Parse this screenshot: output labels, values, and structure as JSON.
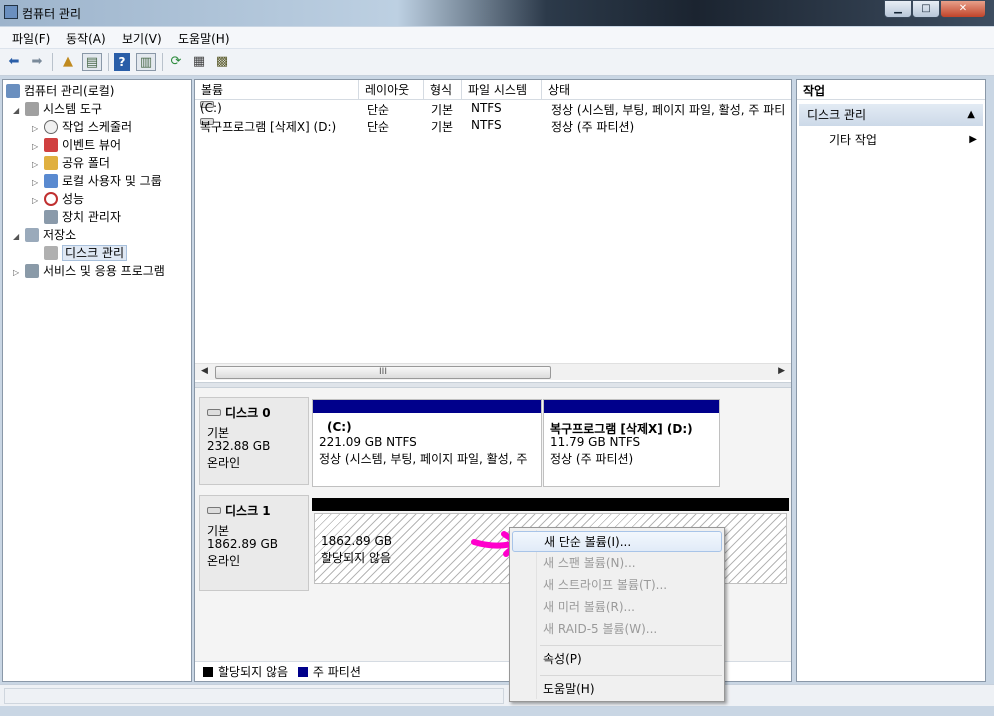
{
  "window": {
    "title": "컴퓨터 관리"
  },
  "window_buttons": {
    "minimize": "▁",
    "maximize": "□",
    "close": "✕"
  },
  "menubar": [
    "파일(F)",
    "동작(A)",
    "보기(V)",
    "도움말(H)"
  ],
  "toolbar": {
    "icons": [
      "back-arrow-icon",
      "forward-arrow-icon",
      "up-folder-icon",
      "show-hide-tree-icon",
      "help-icon",
      "show-hide-action-pane-icon",
      "refresh-icon",
      "properties-icon",
      "export-list-icon"
    ]
  },
  "tree": {
    "root": "컴퓨터 관리(로컬)",
    "system_tools": "시스템 도구",
    "task_scheduler": "작업 스케줄러",
    "event_viewer": "이벤트 뷰어",
    "shared_folders": "공유 폴더",
    "local_users": "로컬 사용자 및 그룹",
    "performance": "성능",
    "device_manager": "장치 관리자",
    "storage": "저장소",
    "disk_management": "디스크 관리",
    "services": "서비스 및 응용 프로그램"
  },
  "volume_list": {
    "columns": [
      "볼륨",
      "레이아웃",
      "형식",
      "파일 시스템",
      "상태"
    ],
    "rows": [
      {
        "volume": "(C:)",
        "layout": "단순",
        "type": "기본",
        "fs": "NTFS",
        "status": "정상 (시스템, 부팅, 페이지 파일, 활성, 주 파티"
      },
      {
        "volume": "복구프로그램 [삭제X] (D:)",
        "layout": "단순",
        "type": "기본",
        "fs": "NTFS",
        "status": "정상 (주 파티션)"
      }
    ],
    "scroll_grip": "III"
  },
  "disks": [
    {
      "name": "디스크 0",
      "kind": "기본",
      "size": "232.88 GB",
      "state": "온라인",
      "partitions": [
        {
          "name": "(C:)",
          "size": "221.09 GB NTFS",
          "status": "정상 (시스템, 부팅, 페이지 파일, 활성, 주",
          "bar_color": "#00008b"
        },
        {
          "name": "복구프로그램 [삭제X]  (D:)",
          "size": "11.79 GB NTFS",
          "status": "정상 (주 파티션)",
          "bar_color": "#00008b"
        }
      ]
    },
    {
      "name": "디스크 1",
      "kind": "기본",
      "size": "1862.89 GB",
      "state": "온라인",
      "partitions": [
        {
          "name": "",
          "size": "1862.89 GB",
          "status": "할당되지 않음",
          "bar_color": "#000000"
        }
      ]
    }
  ],
  "legend": [
    {
      "label": "할당되지 않음",
      "color": "#000000"
    },
    {
      "label": "주 파티션",
      "color": "#00008b"
    }
  ],
  "actions": {
    "header": "작업",
    "section": "디스크 관리",
    "item": "기타 작업"
  },
  "context_menu": {
    "items": [
      {
        "label": "새 단순 볼륨(I)...",
        "enabled": true,
        "highlighted": true
      },
      {
        "label": "새 스팬 볼륨(N)...",
        "enabled": false
      },
      {
        "label": "새 스트라이프 볼륨(T)...",
        "enabled": false
      },
      {
        "label": "새 미러 볼륨(R)...",
        "enabled": false
      },
      {
        "label": "새 RAID-5 볼륨(W)...",
        "enabled": false
      },
      {
        "label": "속성(P)",
        "enabled": true
      },
      {
        "label": "도움말(H)",
        "enabled": true
      }
    ]
  },
  "annotation": {
    "color": "#ff00cc"
  }
}
